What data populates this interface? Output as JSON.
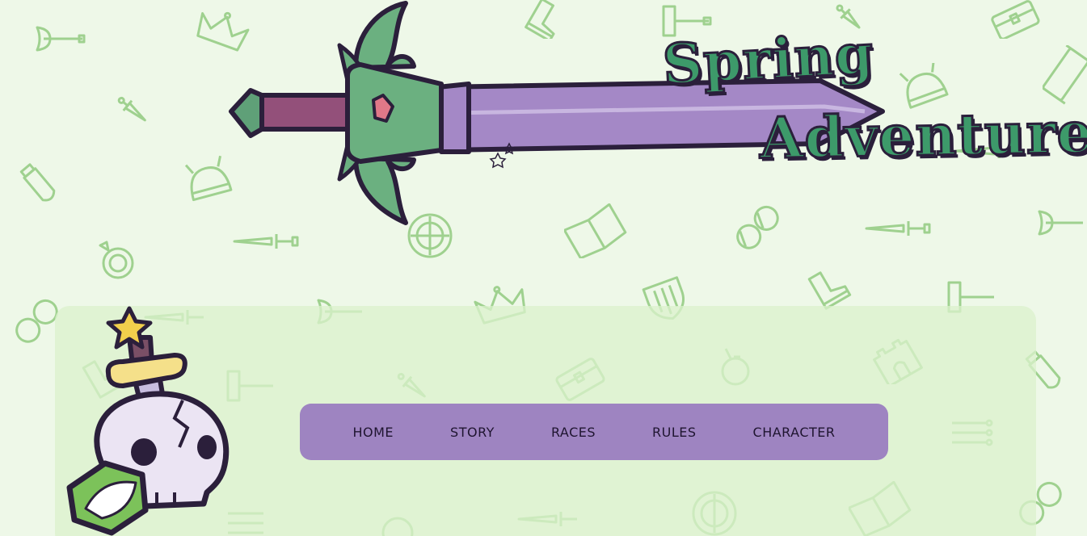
{
  "site": {
    "title_line_1": "Spring",
    "title_line_2": "Adventure"
  },
  "nav": {
    "items": [
      {
        "label": "HOME"
      },
      {
        "label": "STORY"
      },
      {
        "label": "RACES"
      },
      {
        "label": "RULES"
      },
      {
        "label": "CHARACTER"
      }
    ]
  },
  "colors": {
    "page_background": "#eef8e8",
    "panel_background": "#dbf2cc",
    "nav_background": "#9e84c1",
    "nav_text": "#1f1530",
    "pattern_icon": "#9fd18f",
    "title_fill": "#3d9a6a",
    "outline": "#2b1f3b"
  },
  "icons": {
    "background_pattern": [
      "axe-icon",
      "crown-icon",
      "boot-icon",
      "hammer-icon",
      "dagger-icon",
      "book-icon",
      "helmet-icon",
      "potion-icon",
      "ring-icon",
      "coins-icon",
      "shield-icon",
      "castle-icon",
      "arrows-icon",
      "chest-icon",
      "scroll-icon"
    ],
    "banner": "sword-icon",
    "emblem": "skull-sword-icon"
  }
}
